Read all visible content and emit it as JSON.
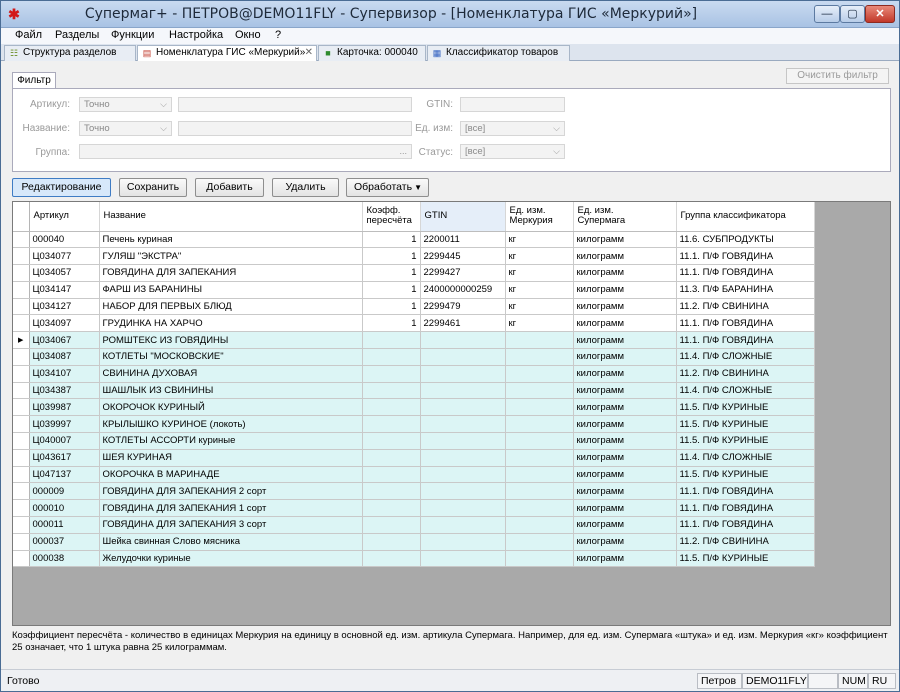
{
  "window": {
    "title": "Супермаг+ - ПЕТРОВ@DEMO11FLY - Супервизор  - [Номенклатура ГИС «Меркурий»]",
    "controls": {
      "minimize": "—",
      "maximize": "▢",
      "close": "✕"
    }
  },
  "menu": [
    "Файл",
    "Разделы",
    "Функции",
    "Настройка",
    "Окно",
    "?"
  ],
  "tabs": [
    {
      "label": "Структура разделов",
      "icon": "tree-icon"
    },
    {
      "label": "Номенклатура ГИС «Меркурий»",
      "icon": "document-icon",
      "close": "✕"
    },
    {
      "label": "Карточка: 000040",
      "icon": "card-icon"
    },
    {
      "label": "Классификатор товаров",
      "icon": "classifier-icon"
    }
  ],
  "filter": {
    "tab_label": "Фильтр",
    "clear_button": "Очистить фильтр",
    "article_label": "Артикул:",
    "article_mode": "Точно",
    "name_label": "Название:",
    "name_mode": "Точно",
    "group_label": "Группа:",
    "group_browse": "...",
    "gtin_label": "GTIN:",
    "unit_label": "Ед. изм:",
    "unit_value": "[все]",
    "status_label": "Статус:",
    "status_value": "[все]"
  },
  "toolbar": {
    "edit": "Редактирование",
    "save": "Сохранить",
    "add": "Добавить",
    "delete": "Удалить",
    "process": "Обработать"
  },
  "grid": {
    "headers": {
      "article": "Артикул",
      "name": "Название",
      "coeff_1": "Коэфф.",
      "coeff_2": "пересчёта",
      "gtin": "GTIN",
      "unit_merc_1": "Ед. изм.",
      "unit_merc_2": "Меркурия",
      "unit_sm_1": "Ед. изм.",
      "unit_sm_2": "Супермага",
      "group": "Группа классификатора"
    },
    "current_row_marker": "▶",
    "rows": [
      {
        "article": "000040",
        "name": "Печень куриная",
        "coeff": "1",
        "gtin": "2200011",
        "unit_merc": "кг",
        "unit_sm": "килограмм",
        "group": "11.6. СУБПРОДУКТЫ"
      },
      {
        "article": "Ц034077",
        "name": "ГУЛЯШ \"ЭКСТРА\"",
        "coeff": "1",
        "gtin": "2299445",
        "unit_merc": "кг",
        "unit_sm": "килограмм",
        "group": "11.1. П/Ф ГОВЯДИНА"
      },
      {
        "article": "Ц034057",
        "name": "ГОВЯДИНА  ДЛЯ ЗАПЕКАНИЯ",
        "coeff": "1",
        "gtin": "2299427",
        "unit_merc": "кг",
        "unit_sm": "килограмм",
        "group": "11.1. П/Ф ГОВЯДИНА"
      },
      {
        "article": "Ц034147",
        "name": "ФАРШ ИЗ БАРАНИНЫ",
        "coeff": "1",
        "gtin": "2400000000259",
        "unit_merc": "кг",
        "unit_sm": "килограмм",
        "group": "11.3. П/Ф БАРАНИНА"
      },
      {
        "article": "Ц034127",
        "name": "НАБОР ДЛЯ ПЕРВЫХ БЛЮД",
        "coeff": "1",
        "gtin": "2299479",
        "unit_merc": "кг",
        "unit_sm": "килограмм",
        "group": "11.2. П/Ф СВИНИНА"
      },
      {
        "article": "Ц034097",
        "name": "ГРУДИНКА  НА ХАРЧО",
        "coeff": "1",
        "gtin": "2299461",
        "unit_merc": "кг",
        "unit_sm": "килограмм",
        "group": "11.1. П/Ф ГОВЯДИНА"
      },
      {
        "article": "Ц034067",
        "name": "РОМШТЕКС ИЗ ГОВЯДИНЫ",
        "coeff": "",
        "gtin": "",
        "unit_merc": "",
        "unit_sm": "килограмм",
        "group": "11.1. П/Ф ГОВЯДИНА"
      },
      {
        "article": "Ц034087",
        "name": "КОТЛЕТЫ \"МОСКОВСКИЕ\"",
        "coeff": "",
        "gtin": "",
        "unit_merc": "",
        "unit_sm": "килограмм",
        "group": "11.4. П/Ф СЛОЖНЫЕ"
      },
      {
        "article": "Ц034107",
        "name": "СВИНИНА ДУХОВАЯ",
        "coeff": "",
        "gtin": "",
        "unit_merc": "",
        "unit_sm": "килограмм",
        "group": "11.2. П/Ф СВИНИНА"
      },
      {
        "article": "Ц034387",
        "name": "ШАШЛЫК ИЗ СВИНИНЫ",
        "coeff": "",
        "gtin": "",
        "unit_merc": "",
        "unit_sm": "килограмм",
        "group": "11.4. П/Ф СЛОЖНЫЕ"
      },
      {
        "article": "Ц039987",
        "name": "ОКОРОЧОК КУРИНЫЙ",
        "coeff": "",
        "gtin": "",
        "unit_merc": "",
        "unit_sm": "килограмм",
        "group": "11.5. П/Ф КУРИНЫЕ"
      },
      {
        "article": "Ц039997",
        "name": "КРЫЛЫШКО КУРИНОЕ (локоть)",
        "coeff": "",
        "gtin": "",
        "unit_merc": "",
        "unit_sm": "килограмм",
        "group": "11.5. П/Ф КУРИНЫЕ"
      },
      {
        "article": "Ц040007",
        "name": "КОТЛЕТЫ АССОРТИ куриные",
        "coeff": "",
        "gtin": "",
        "unit_merc": "",
        "unit_sm": "килограмм",
        "group": "11.5. П/Ф КУРИНЫЕ"
      },
      {
        "article": "Ц043617",
        "name": "ШЕЯ КУРИНАЯ",
        "coeff": "",
        "gtin": "",
        "unit_merc": "",
        "unit_sm": "килограмм",
        "group": "11.4. П/Ф СЛОЖНЫЕ"
      },
      {
        "article": "Ц047137",
        "name": "ОКОРОЧКА В МАРИНАДЕ",
        "coeff": "",
        "gtin": "",
        "unit_merc": "",
        "unit_sm": "килограмм",
        "group": "11.5. П/Ф КУРИНЫЕ"
      },
      {
        "article": "000009",
        "name": "ГОВЯДИНА  ДЛЯ ЗАПЕКАНИЯ 2 сорт",
        "coeff": "",
        "gtin": "",
        "unit_merc": "",
        "unit_sm": "килограмм",
        "group": "11.1. П/Ф ГОВЯДИНА"
      },
      {
        "article": "000010",
        "name": "ГОВЯДИНА  ДЛЯ ЗАПЕКАНИЯ 1 сорт",
        "coeff": "",
        "gtin": "",
        "unit_merc": "",
        "unit_sm": "килограмм",
        "group": "11.1. П/Ф ГОВЯДИНА"
      },
      {
        "article": "000011",
        "name": "ГОВЯДИНА  ДЛЯ ЗАПЕКАНИЯ 3 сорт",
        "coeff": "",
        "gtin": "",
        "unit_merc": "",
        "unit_sm": "килограмм",
        "group": "11.1. П/Ф ГОВЯДИНА"
      },
      {
        "article": "000037",
        "name": "Шейка свинная Слово мясника",
        "coeff": "",
        "gtin": "",
        "unit_merc": "",
        "unit_sm": "килограмм",
        "group": "11.2. П/Ф СВИНИНА"
      },
      {
        "article": "000038",
        "name": "Желудочки куриные",
        "coeff": "",
        "gtin": "",
        "unit_merc": "",
        "unit_sm": "килограмм",
        "group": "11.5. П/Ф КУРИНЫЕ"
      }
    ]
  },
  "note": "Коэффициент пересчёта  - количество в единицах Меркурия на единицу в основной ед. изм. артикула Супермага. Например, для ед. изм. Супермага «штука» и ед. изм. Меркурия «кг» коэффициент 25 означает, что 1 штука равна 25 килограммам.",
  "status": {
    "ready": "Готово",
    "user": "Петров",
    "db": "DEMO11FLY",
    "num": "NUM",
    "lang": "RU"
  },
  "colors": {
    "unmapped_row": "#dcf5f5",
    "mapped_row": "#ffffff",
    "active_button": "#d7e8fa"
  }
}
